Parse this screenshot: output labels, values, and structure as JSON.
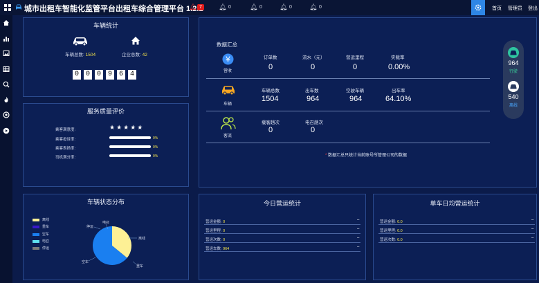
{
  "topbar": {
    "title": "城市出租车智能化监管平台出租车综合管理平台 1.2.1",
    "alert_count": "7",
    "counts": [
      "0",
      "0",
      "0",
      "0"
    ],
    "nav": [
      "首页",
      "管理员",
      "登出"
    ]
  },
  "vehicle_stats": {
    "title": "车辆统计",
    "total_label": "车辆总数:",
    "total_value": "1504",
    "company_label": "企业总数:",
    "company_value": "42",
    "digits": [
      "0",
      "0",
      "0",
      "9",
      "6",
      "4"
    ]
  },
  "service_quality": {
    "title": "服务质量评价",
    "rows": [
      {
        "label": "乘客满意度:",
        "type": "stars",
        "value": "★★★★★"
      },
      {
        "label": "乘客投诉率:",
        "type": "bar",
        "value": "0%",
        "fraction": 0
      },
      {
        "label": "乘客表扬率:",
        "type": "bar",
        "value": "0%",
        "fraction": 0
      },
      {
        "label": "司机满分率:",
        "type": "bar",
        "value": "0%",
        "fraction": 0
      }
    ]
  },
  "summary": {
    "title": "数据汇总",
    "groups": [
      {
        "caption": "营收",
        "items": [
          {
            "label": "订单数",
            "value": "0"
          },
          {
            "label": "流水（元）",
            "value": "0"
          },
          {
            "label": "营运里程",
            "value": "0"
          },
          {
            "label": "实载率",
            "value": "0.00%"
          }
        ]
      },
      {
        "caption": "车辆",
        "items": [
          {
            "label": "车辆总数",
            "value": "1504"
          },
          {
            "label": "出车数",
            "value": "964"
          },
          {
            "label": "空驶车辆",
            "value": "964"
          },
          {
            "label": "出车率",
            "value": "64.10%"
          }
        ]
      },
      {
        "caption": "客流",
        "items": [
          {
            "label": "载客趟次",
            "value": "0"
          },
          {
            "label": "电召趟次",
            "value": "0"
          }
        ]
      }
    ],
    "note": "数据汇总只统计当前账号所管理公司的数据",
    "note_star": "*"
  },
  "floater": {
    "driving_value": "964",
    "driving_label": "行驶",
    "offline_value": "540",
    "offline_label": "离线"
  },
  "vehicle_status": {
    "title": "车辆状态分布",
    "legend": [
      {
        "name": "离线",
        "color": "#fdf095"
      },
      {
        "name": "重车",
        "color": "#3a18c8"
      },
      {
        "name": "空车",
        "color": "#1a7ff0"
      },
      {
        "name": "电召",
        "color": "#5fe0f0"
      },
      {
        "name": "停运",
        "color": "#7a7a7a"
      }
    ],
    "pie_labels": [
      "电召",
      "停运",
      "离线",
      "空车",
      "重车"
    ]
  },
  "chart_data": {
    "type": "pie",
    "categories": [
      "离线",
      "重车",
      "空车",
      "电召",
      "停运"
    ],
    "values": [
      540,
      0,
      964,
      0,
      0
    ],
    "colors": [
      "#fdf095",
      "#3a18c8",
      "#1a7ff0",
      "#5fe0f0",
      "#7a7a7a"
    ]
  },
  "today_ops": {
    "title": "今日营运统计",
    "rows": [
      {
        "label": "营运金额:",
        "value": "0",
        "dash": "–"
      },
      {
        "label": "营运里程:",
        "value": "0",
        "dash": "–"
      },
      {
        "label": "营运次数:",
        "value": "0",
        "dash": "–"
      },
      {
        "label": "营运车数:",
        "value": "964",
        "dash": "–"
      }
    ]
  },
  "avg_ops": {
    "title": "单车日均营运统计",
    "rows": [
      {
        "label": "营运金额:",
        "value": "0.0",
        "dash": "–"
      },
      {
        "label": "营运里程:",
        "value": "0.0",
        "dash": "–"
      },
      {
        "label": "营运次数:",
        "value": "0.0",
        "dash": "–"
      }
    ]
  }
}
